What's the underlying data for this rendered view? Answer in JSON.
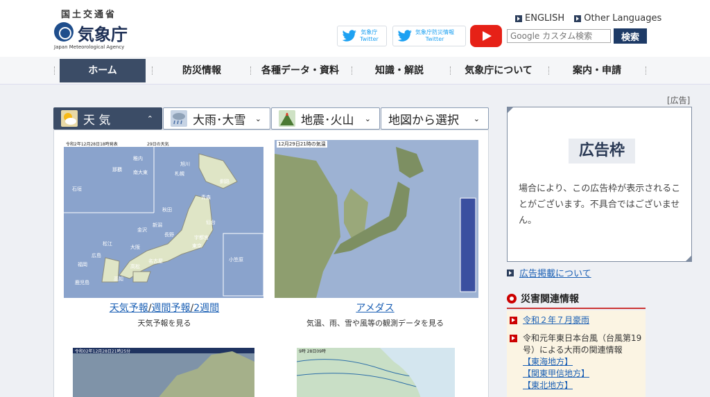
{
  "header": {
    "ministry": "国土交通省",
    "agency": "気象庁",
    "agency_en": "Japan Meteorological Agency",
    "lang_links": [
      "ENGLISH",
      "Other Languages"
    ],
    "twitter1": {
      "line1": "気象庁",
      "line2": "Twitter"
    },
    "twitter2": {
      "line1": "気象庁防災情報",
      "line2": "Twitter"
    },
    "search_placeholder": "Google カスタム検索",
    "search_button": "検索"
  },
  "nav": {
    "items": [
      "ホーム",
      "防災情報",
      "各種データ・資料",
      "知識・解説",
      "気象庁について",
      "案内・申請"
    ],
    "active": "ホーム"
  },
  "tabs": {
    "items": [
      {
        "label": "天 気",
        "chevron": "⌃"
      },
      {
        "label": "大雨･大雪",
        "chevron": "⌄"
      },
      {
        "label": "地震･火山",
        "chevron": "⌄"
      },
      {
        "label": "地図から選択",
        "chevron": "⌄"
      }
    ]
  },
  "cards": {
    "forecast": {
      "links": [
        "天気予報",
        "週間予報",
        "2週間"
      ],
      "desc": "天気予報を見る",
      "map_title": "令和2年12月28日18時発表",
      "map_sub": "29日の天気",
      "map_cities": [
        "稚内",
        "旭川",
        "札幌",
        "釧路",
        "青森",
        "秋田",
        "仙台",
        "新潟",
        "長野",
        "宇都宮",
        "東京",
        "金沢",
        "名古屋",
        "大阪",
        "松江",
        "広島",
        "高松",
        "福岡",
        "高知",
        "鹿児島",
        "那覇",
        "石垣",
        "南大東",
        "小笠原"
      ]
    },
    "amedas": {
      "link": "アメダス",
      "desc": "気温、雨、雪や風等の観測データを見る",
      "map_title": "12月29日21時の気温"
    },
    "radar": {
      "map_title": "令和02年12月28日21時25分"
    },
    "chart": {
      "map_title": "9時 28日09時"
    }
  },
  "sidebar": {
    "ad_label": "[広告]",
    "ad_title": "広告枠",
    "ad_text": "場合により、この広告枠が表示されることがございます。不具合ではございません。",
    "ad_about": "広告掲載について",
    "disaster_title": "災害関連情報",
    "disaster_items": [
      {
        "text": "令和２年７月豪雨"
      },
      {
        "text": "令和元年東日本台風（台風第19号）による大雨の関連情報"
      }
    ],
    "disaster_sublinks": [
      "【東海地方】",
      "【関東甲信地方】",
      "【東北地方】"
    ]
  },
  "colors": {
    "nav_active": "#3b4c66",
    "search_button": "#1d3a66",
    "link": "#1a5fb4",
    "youtube": "#e62117",
    "twitter": "#1da1f2",
    "disaster_bg": "#fbf4e3"
  }
}
